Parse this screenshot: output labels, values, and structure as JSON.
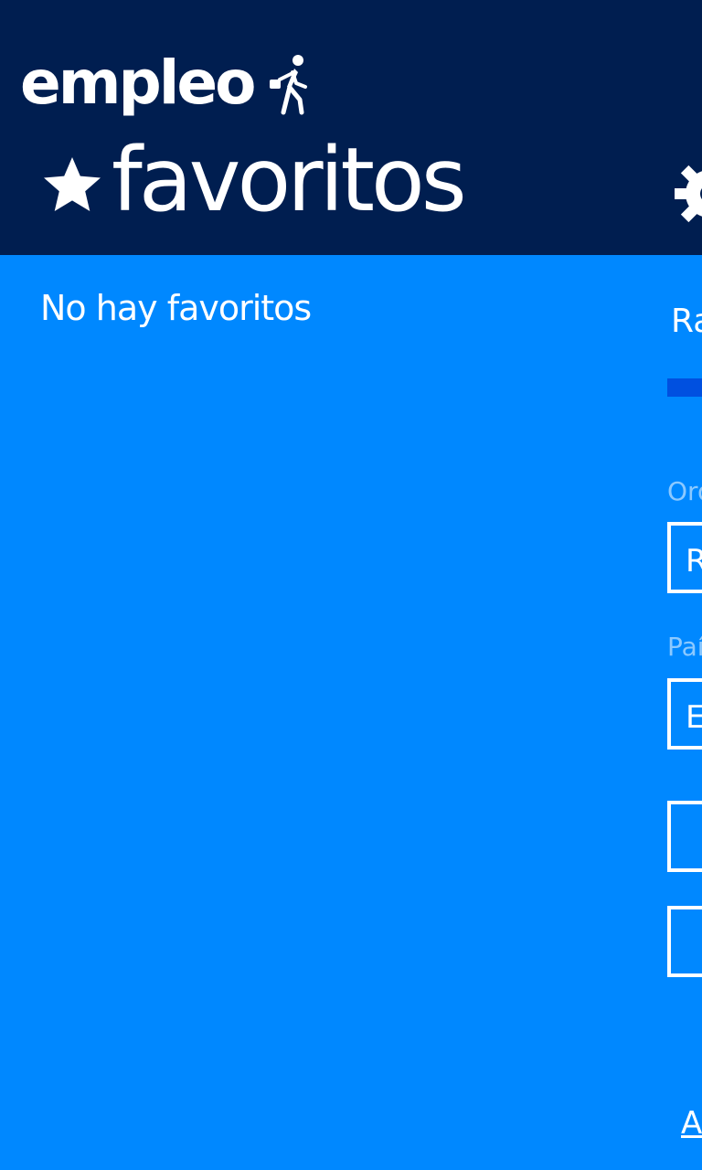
{
  "header": {
    "app_name": "empleo",
    "app_icon": "walking-person-icon",
    "pivot_title": "favoritos",
    "pivot_icon": "star-icon",
    "settings_icon": "gear-icon"
  },
  "favorites": {
    "empty_message": "No hay favoritos"
  },
  "next_panel": {
    "heading": "Ra",
    "sort_label": "Ord",
    "sort_value": "R",
    "country_label": "Paí",
    "country_value": "E",
    "link": "A"
  },
  "colors": {
    "header_bg": "#001e50",
    "body_bg": "#0088ff",
    "accent": "#0050e0",
    "text": "#ffffff"
  }
}
